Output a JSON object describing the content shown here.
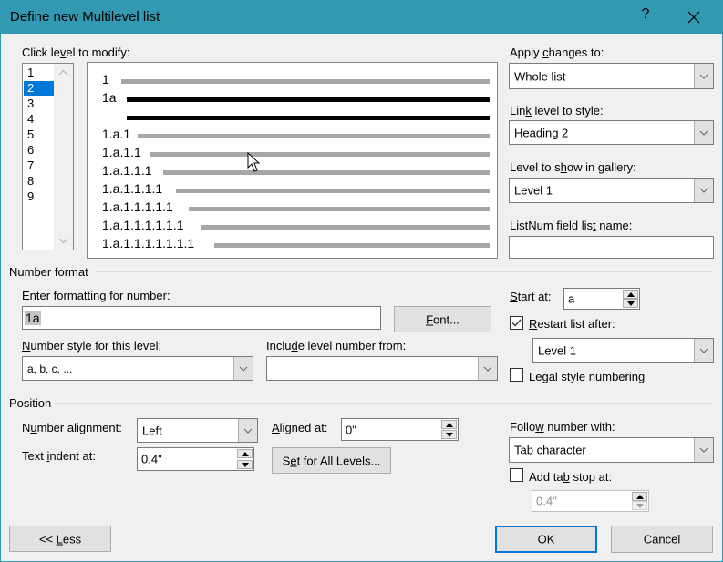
{
  "window": {
    "title": "Define new Multilevel list",
    "help_label": "?",
    "close_icon": "close-icon"
  },
  "level_picker": {
    "label_pre": "Click le",
    "label_mn": "v",
    "label_post": "el to modify:",
    "levels": [
      "1",
      "2",
      "3",
      "4",
      "5",
      "6",
      "7",
      "8",
      "9"
    ],
    "selected": "2"
  },
  "preview": {
    "lines": [
      {
        "number": "1",
        "style": "light"
      },
      {
        "number": "1a",
        "style": "dark"
      },
      {
        "number": "",
        "style": "dark"
      },
      {
        "number": "1.a.1",
        "style": "light"
      },
      {
        "number": "1.a.1.1",
        "style": "light"
      },
      {
        "number": "1.a.1.1.1",
        "style": "light"
      },
      {
        "number": "1.a.1.1.1.1",
        "style": "light"
      },
      {
        "number": "1.a.1.1.1.1.1",
        "style": "light"
      },
      {
        "number": "1.a.1.1.1.1.1.1",
        "style": "light"
      },
      {
        "number": "1.a.1.1.1.1.1.1.1",
        "style": "light"
      }
    ]
  },
  "right_panel": {
    "apply_changes": {
      "pre": "Apply ",
      "mn": "c",
      "post": "hanges to:",
      "value": "Whole list"
    },
    "link_level": {
      "pre": "Lin",
      "mn": "k",
      "post": " level to style:",
      "value": "Heading 2"
    },
    "gallery_level": {
      "pre": "Level to s",
      "mn": "h",
      "post": "ow in gallery:",
      "value": "Level 1"
    },
    "listnum": {
      "pre": "ListNum field lis",
      "mn": "t",
      "post": " name:",
      "value": ""
    }
  },
  "number_format": {
    "section_label": "Number format",
    "enter_formatting": {
      "pre": "Enter f",
      "mn": "o",
      "post": "rmatting for number:",
      "value_num": "1a"
    },
    "font_button": {
      "mn": "F",
      "post": "ont..."
    },
    "number_style": {
      "mn": "N",
      "post": "umber style for this level:",
      "value": "a, b, c, ..."
    },
    "include_level": {
      "pre": "Inclu",
      "mn": "d",
      "post": "e level number from:",
      "value": ""
    },
    "start_at": {
      "mn": "S",
      "post": "tart at:",
      "value": "a"
    },
    "restart_list": {
      "mn": "R",
      "post": "estart list after:",
      "checked": true,
      "value": "Level 1"
    },
    "legal_style": {
      "pre": "Le",
      "mn": "g",
      "post": "al style numbering",
      "checked": false
    }
  },
  "position": {
    "section_label": "Position",
    "number_alignment": {
      "pre": "N",
      "mn": "u",
      "post": "mber alignment:",
      "value": "Left"
    },
    "aligned_at": {
      "mn": "A",
      "post": "ligned at:",
      "value": "0\""
    },
    "text_indent": {
      "pre": "Text ",
      "mn": "i",
      "post": "ndent at:",
      "value": "0.4\""
    },
    "set_all_levels": {
      "pre": "S",
      "mn": "e",
      "post": "t for All Levels..."
    },
    "follow_number": {
      "pre": "Follo",
      "mn": "w",
      "post": " number with:",
      "value": "Tab character"
    },
    "add_tab_stop": {
      "pre": "Add ta",
      "mn": "b",
      "post": " stop at:",
      "checked": false,
      "value": "0.4\""
    }
  },
  "footer": {
    "less_pre": "<< ",
    "less_mn": "L",
    "less_post": "ess",
    "ok": "OK",
    "cancel": "Cancel"
  }
}
